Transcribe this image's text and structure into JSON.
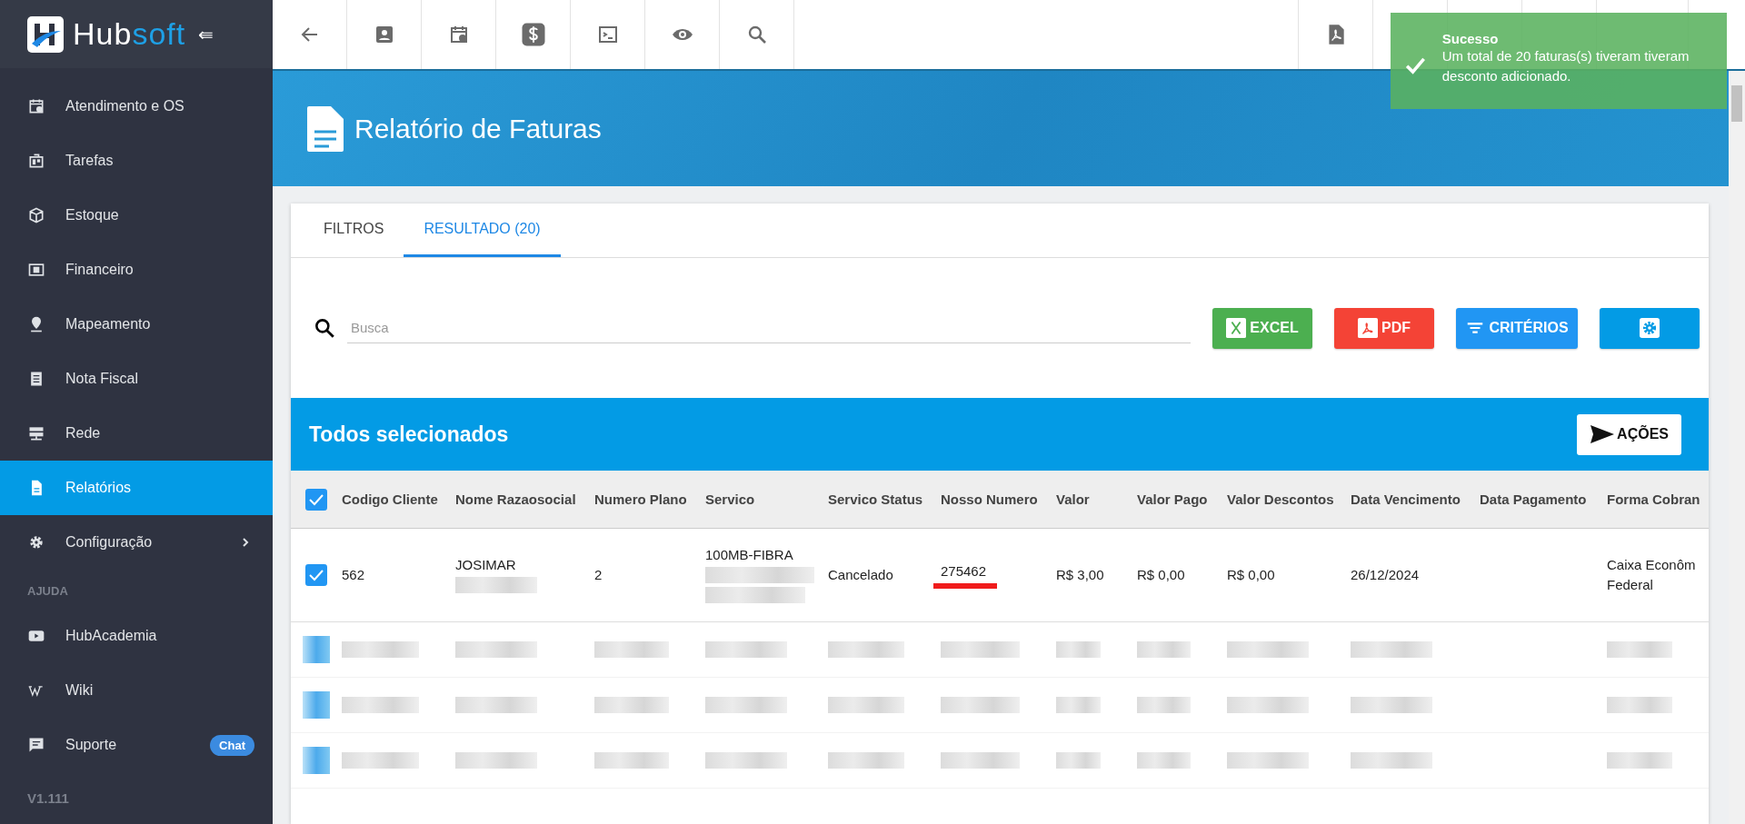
{
  "sidebar": {
    "logo": {
      "brand_a": "Hub",
      "brand_b": "soft",
      "collapse": "⇚"
    },
    "items": [
      {
        "label": "Atendimento e OS",
        "selected": false
      },
      {
        "label": "Tarefas",
        "selected": false
      },
      {
        "label": "Estoque",
        "selected": false
      },
      {
        "label": "Financeiro",
        "selected": false
      },
      {
        "label": "Mapeamento",
        "selected": false
      },
      {
        "label": "Nota Fiscal",
        "selected": false
      },
      {
        "label": "Rede",
        "selected": false
      },
      {
        "label": "Relatórios",
        "selected": true
      },
      {
        "label": "Configuração",
        "selected": false,
        "submenu": true
      }
    ],
    "section": "AJUDA",
    "help_items": [
      {
        "label": "HubAcademia"
      },
      {
        "label": "Wiki"
      },
      {
        "label": "Suporte",
        "badge": "Chat"
      }
    ],
    "version": "V1.111"
  },
  "toast": {
    "title": "Sucesso",
    "message": "Um total de 20 faturas(s) tiveram tiveram desconto adicionado."
  },
  "page": {
    "title": "Relatório de Faturas"
  },
  "tabs": [
    {
      "label": "FILTROS",
      "selected": false
    },
    {
      "label": "RESULTADO (20)",
      "selected": true
    }
  ],
  "search": {
    "placeholder": "Busca"
  },
  "buttons": [
    {
      "kind": "excel",
      "label": "EXCEL"
    },
    {
      "kind": "pdf",
      "label": "PDF"
    },
    {
      "kind": "criteria",
      "label": "CRITÉRIOS"
    },
    {
      "kind": "settings"
    }
  ],
  "table": {
    "selection_title": "Todos selecionados",
    "actions_button": "AÇÕES",
    "all_checked": true,
    "columns": [
      "Codigo Cliente",
      "Nome Razaosocial",
      "Numero Plano",
      "Servico",
      "Servico Status",
      "Nosso Numero",
      "Valor",
      "Valor Pago",
      "Valor Descontos",
      "Data Vencimento",
      "Data Pagamento",
      "Forma Cobran"
    ],
    "rows": [
      {
        "kind": "data",
        "checked": true,
        "cells": [
          {
            "text": "562"
          },
          {
            "text": "JOSIMAR",
            "redacted": true
          },
          {
            "text": "2"
          },
          {
            "text": "100MB-FIBRA",
            "redacted": true
          },
          {
            "text": "Cancelado"
          },
          {
            "text": "275462",
            "marked": true
          },
          {
            "text": "R$ 3,00"
          },
          {
            "text": "R$ 0,00"
          },
          {
            "text": "R$ 0,00"
          },
          {
            "text": "26/12/2024"
          },
          {},
          {
            "text": "Caixa Econôm Federal"
          }
        ]
      },
      {
        "kind": "redacted",
        "checked": true
      },
      {
        "kind": "redacted",
        "checked": true
      },
      {
        "kind": "redacted",
        "checked": true
      }
    ]
  }
}
